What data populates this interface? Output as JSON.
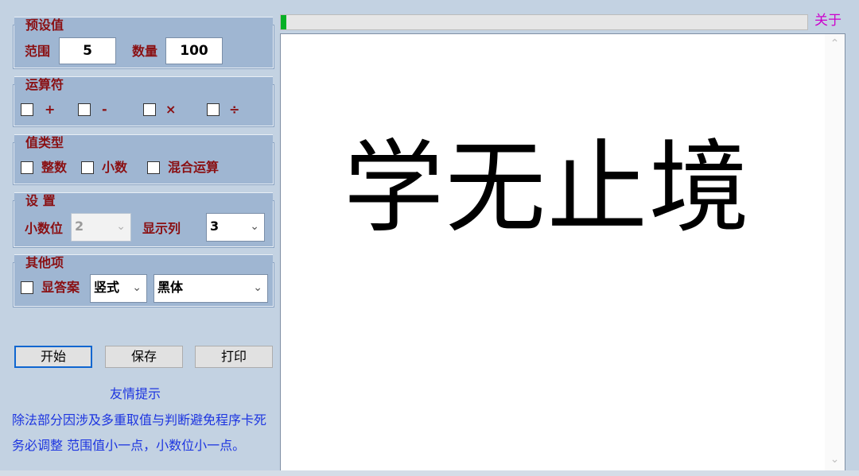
{
  "presets": {
    "title": "预设值",
    "range_label": "范围",
    "range_value": "5",
    "count_label": "数量",
    "count_value": "100"
  },
  "operators": {
    "title": "运算符",
    "items": [
      {
        "symbol": "+",
        "checked": false
      },
      {
        "symbol": "-",
        "checked": false
      },
      {
        "symbol": "×",
        "checked": false
      },
      {
        "symbol": "÷",
        "checked": false
      }
    ]
  },
  "value_type": {
    "title": "值类型",
    "items": [
      {
        "label": "整数",
        "checked": false
      },
      {
        "label": "小数",
        "checked": false
      },
      {
        "label": "混合运算",
        "checked": false
      }
    ]
  },
  "settings": {
    "title": "设 置",
    "decimals_label": "小数位",
    "decimals_value": "2",
    "columns_label": "显示列",
    "columns_value": "3"
  },
  "other": {
    "title": "其他项",
    "show_answer_label": "显答案",
    "show_answer_checked": false,
    "layout_value": "竖式",
    "font_value": "黑体"
  },
  "buttons": {
    "start": "开始",
    "save": "保存",
    "print": "打印"
  },
  "tips": {
    "title": "友情提示",
    "line1": "除法部分因涉及多重取值与判断避免程序卡死",
    "line2": "务必调整 范围值小一点，小数位小一点。"
  },
  "about_label": "关于",
  "progress_fraction": 0.01,
  "output_text": "学无止境",
  "colors": {
    "panel_bg": "#9fb6d2",
    "label_red": "#8a0f12",
    "tip_blue": "#1d35e0",
    "about_magenta": "#cc00cc",
    "progress_green": "#06b025"
  },
  "icons": {
    "dropdown": "chevron-down-icon",
    "scroll_up": "scroll-up-arrow-icon",
    "scroll_down": "scroll-down-arrow-icon"
  }
}
